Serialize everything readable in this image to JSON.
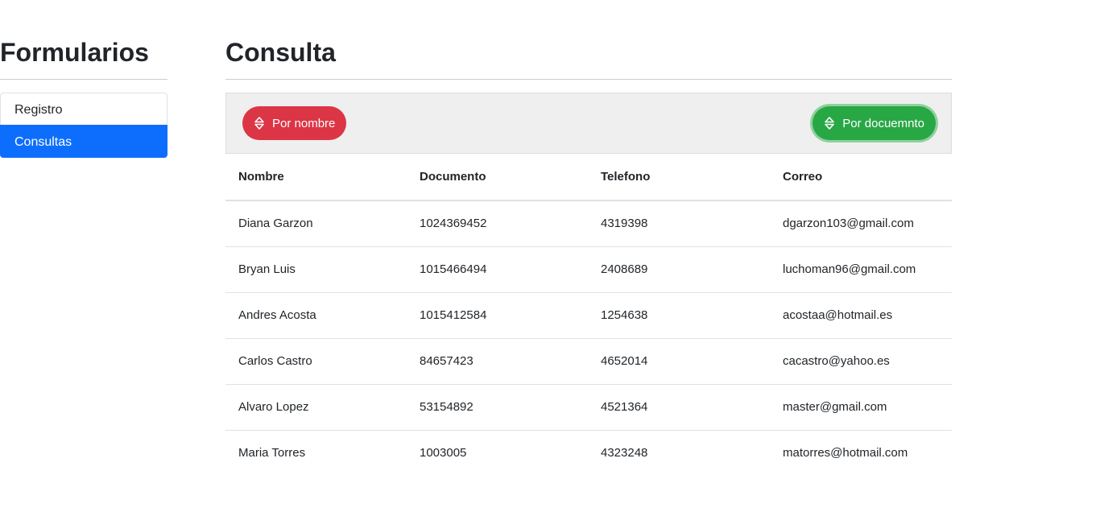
{
  "sidebar": {
    "title": "Formularios",
    "items": [
      {
        "label": "Registro",
        "active": false
      },
      {
        "label": "Consultas",
        "active": true
      }
    ]
  },
  "main": {
    "title": "Consulta",
    "toolbar": {
      "sort_by_name": {
        "label": "Por nombre",
        "icon": "sort-icon",
        "color": "#dc3545"
      },
      "sort_by_document": {
        "label": "Por docuemnto",
        "icon": "sort-icon",
        "color": "#28a745"
      }
    },
    "table": {
      "headers": [
        "Nombre",
        "Documento",
        "Telefono",
        "Correo"
      ],
      "rows": [
        [
          "Diana Garzon",
          "1024369452",
          "4319398",
          "dgarzon103@gmail.com"
        ],
        [
          "Bryan Luis",
          "1015466494",
          "2408689",
          "luchoman96@gmail.com"
        ],
        [
          "Andres Acosta",
          "1015412584",
          "1254638",
          "acostaa@hotmail.es"
        ],
        [
          "Carlos Castro",
          "84657423",
          "4652014",
          "cacastro@yahoo.es"
        ],
        [
          "Alvaro Lopez",
          "53154892",
          "4521364",
          "master@gmail.com"
        ],
        [
          "Maria Torres",
          "1003005",
          "4323248",
          "matorres@hotmail.com"
        ]
      ]
    }
  },
  "colors": {
    "active": "#0d6efd",
    "danger": "#dc3545",
    "success": "#28a745"
  }
}
